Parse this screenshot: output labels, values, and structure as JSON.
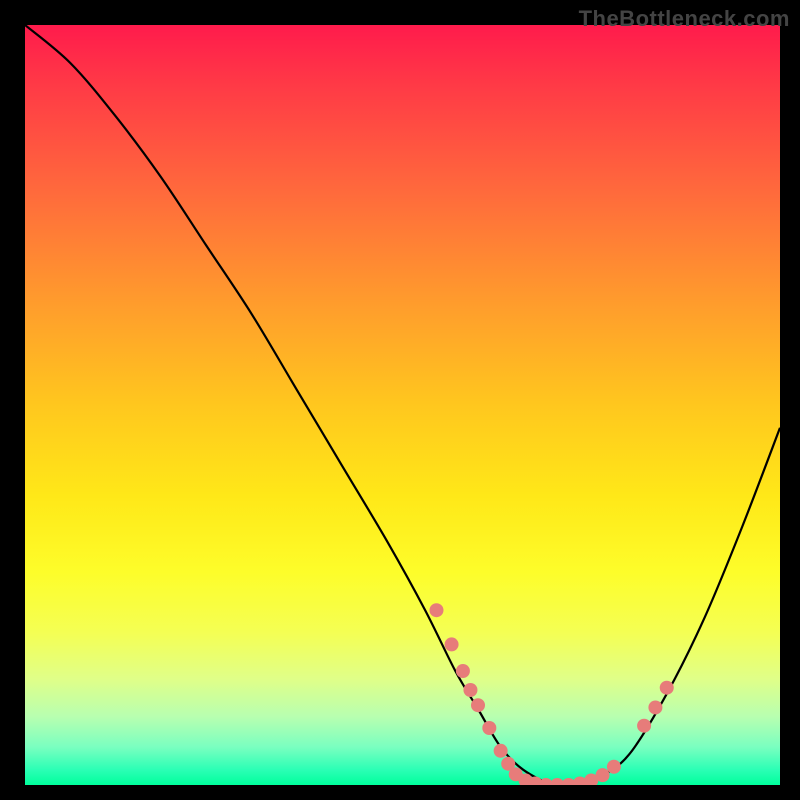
{
  "watermark": "TheBottleneck.com",
  "chart_data": {
    "type": "line",
    "title": "",
    "xlabel": "",
    "ylabel": "",
    "xlim": [
      0,
      100
    ],
    "ylim": [
      0,
      100
    ],
    "series": [
      {
        "name": "curve",
        "x": [
          0,
          6,
          12,
          18,
          24,
          30,
          36,
          42,
          48,
          53,
          57,
          60,
          63,
          66,
          70,
          73,
          76,
          80,
          85,
          90,
          95,
          100
        ],
        "y": [
          100,
          95,
          88,
          80,
          71,
          62,
          52,
          42,
          32,
          23,
          15,
          10,
          5,
          2,
          0,
          0,
          1,
          4,
          12,
          22,
          34,
          47
        ]
      }
    ],
    "points": [
      {
        "x": 54.5,
        "y": 23.0
      },
      {
        "x": 56.5,
        "y": 18.5
      },
      {
        "x": 58.0,
        "y": 15.0
      },
      {
        "x": 59.0,
        "y": 12.5
      },
      {
        "x": 60.0,
        "y": 10.5
      },
      {
        "x": 61.5,
        "y": 7.5
      },
      {
        "x": 63.0,
        "y": 4.5
      },
      {
        "x": 64.0,
        "y": 2.8
      },
      {
        "x": 65.0,
        "y": 1.4
      },
      {
        "x": 66.3,
        "y": 0.6
      },
      {
        "x": 67.6,
        "y": 0.2
      },
      {
        "x": 69.0,
        "y": 0.0
      },
      {
        "x": 70.5,
        "y": 0.0
      },
      {
        "x": 72.0,
        "y": 0.0
      },
      {
        "x": 73.5,
        "y": 0.2
      },
      {
        "x": 75.0,
        "y": 0.6
      },
      {
        "x": 76.5,
        "y": 1.3
      },
      {
        "x": 78.0,
        "y": 2.4
      },
      {
        "x": 82.0,
        "y": 7.8
      },
      {
        "x": 83.5,
        "y": 10.2
      },
      {
        "x": 85.0,
        "y": 12.8
      }
    ],
    "gradient_background": true
  }
}
